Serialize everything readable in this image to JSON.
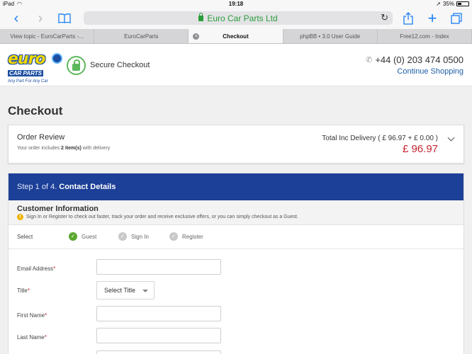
{
  "status_bar": {
    "device": "iPad",
    "time": "19:18",
    "battery": "35%"
  },
  "browser": {
    "url_text": "Euro Car Parts Ltd",
    "tabs": [
      {
        "label": "View topic - EuroCarParts -..."
      },
      {
        "label": "EuroCarParts"
      },
      {
        "label": "Checkout",
        "active": true
      },
      {
        "label": "phpBB • 3.0 User Guide"
      },
      {
        "label": "Free12.com - Index"
      }
    ],
    "icons": [
      "back-icon",
      "forward-icon",
      "bookmarks-icon",
      "reload-icon",
      "share-icon",
      "new-tab-icon",
      "tabs-icon"
    ]
  },
  "header": {
    "logo_word": "euro",
    "logo_sub": "CAR PARTS",
    "logo_tagline": "Any Part For Any Car",
    "secure_label": "Secure Checkout",
    "phone": "+44 (0) 203 474 0500",
    "continue_label": "Continue Shopping"
  },
  "checkout": {
    "page_title": "Checkout",
    "order_review": {
      "title": "Order Review",
      "sub_prefix": "Your order includes ",
      "items": "2 item(s)",
      "sub_suffix": " with delivery",
      "total_text": "Total Inc Delivery ( £ 96.97 + £ 0.00 )",
      "total_price": "£ 96.97"
    },
    "step": {
      "prefix": "Step 1 of 4.",
      "title": "Contact Details"
    },
    "customer_info": {
      "title": "Customer Information",
      "note": "Sign In or Register to check out faster, track your order and receive exclusive offers, or you can simply checkout as a Guest."
    },
    "select": {
      "label": "Select",
      "options": [
        {
          "label": "Guest",
          "selected": true
        },
        {
          "label": "Sign In",
          "selected": false
        },
        {
          "label": "Register",
          "selected": false
        }
      ]
    },
    "fields": {
      "email_label": "Email Address",
      "title_label": "Title",
      "title_value": "Select Title",
      "first_name_label": "First Name",
      "last_name_label": "Last Name",
      "required_mark": "*"
    }
  },
  "colors": {
    "brand_blue": "#1c3f97",
    "price_red": "#c8242f",
    "secure_green": "#5cb85c",
    "link_blue": "#1e5fa8"
  }
}
